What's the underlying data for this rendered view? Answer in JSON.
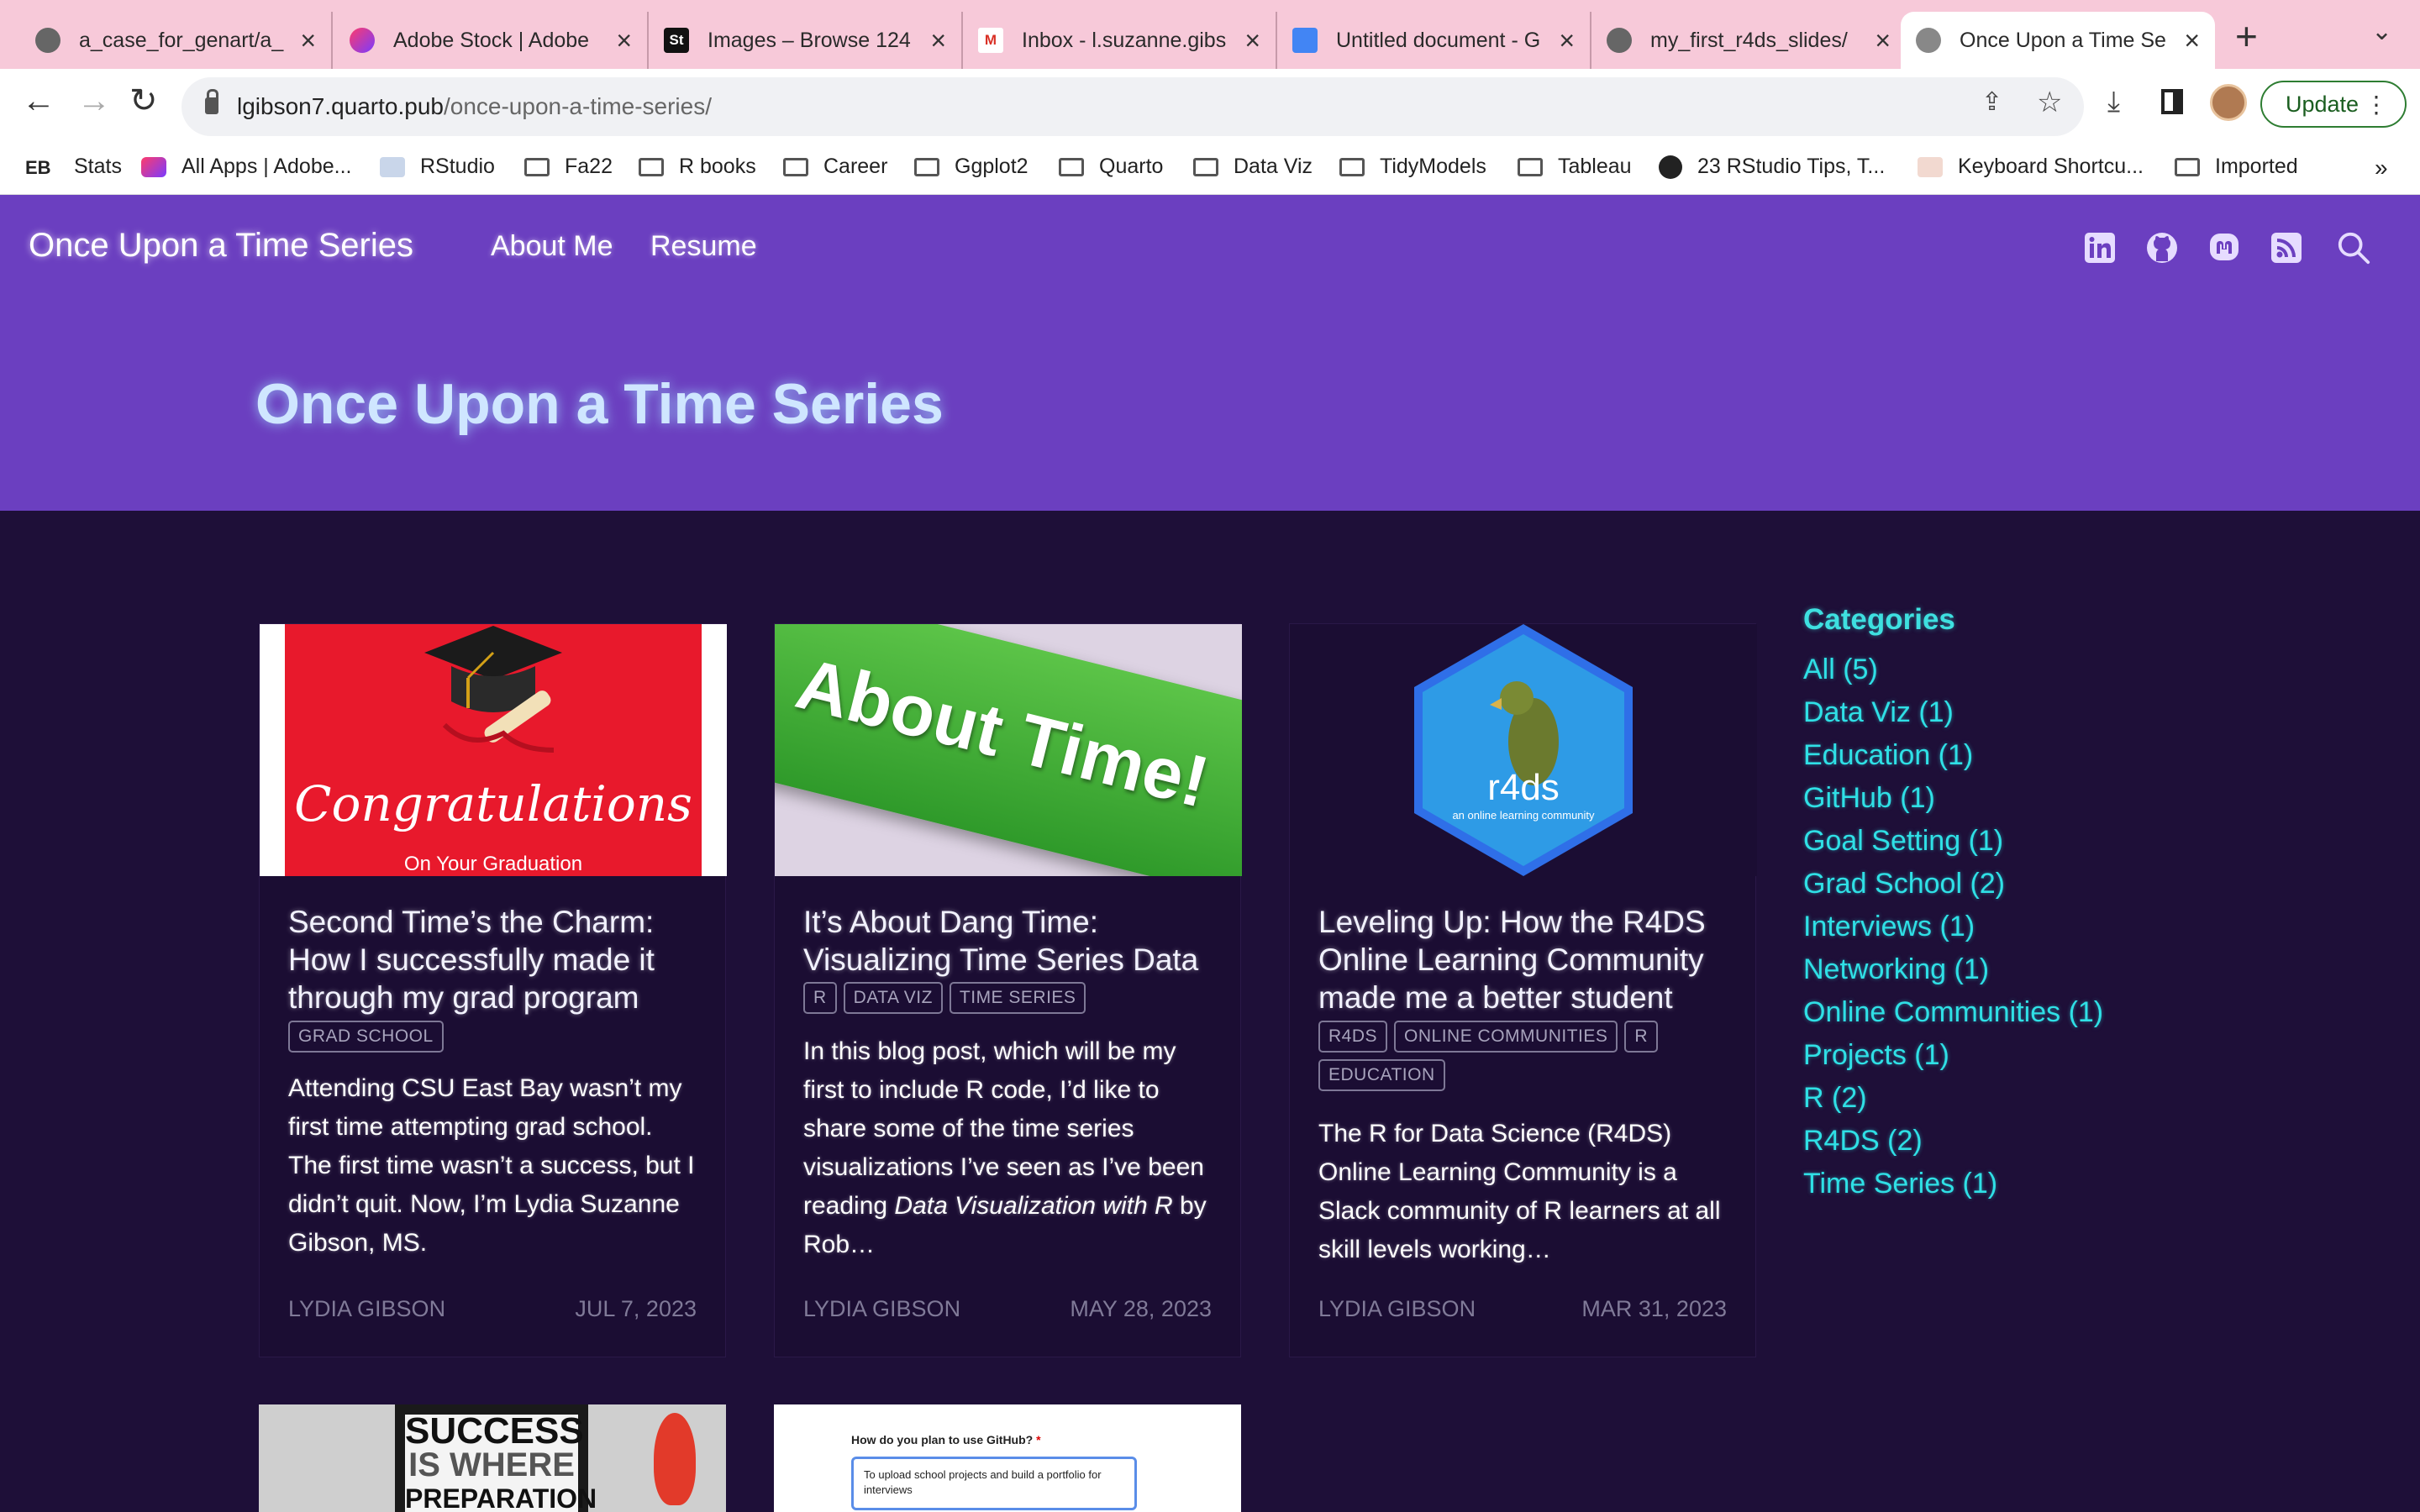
{
  "browser": {
    "tabs": [
      {
        "title": "a_case_for_genart/a_",
        "icon": "github-icon"
      },
      {
        "title": "Adobe Stock | Adobe",
        "icon": "adobe-cc-icon"
      },
      {
        "title": "Images – Browse 124",
        "icon": "adobe-stock-icon",
        "badge": "St"
      },
      {
        "title": "Inbox - l.suzanne.gibs",
        "icon": "gmail-icon",
        "badge": "M"
      },
      {
        "title": "Untitled document - G",
        "icon": "google-docs-icon"
      },
      {
        "title": "my_first_r4ds_slides/",
        "icon": "github-icon"
      },
      {
        "title": "Once Upon a Time Se",
        "icon": "globe-icon"
      }
    ],
    "address": {
      "host": "lgibson7.quarto.pub",
      "path": "/once-upon-a-time-series/"
    },
    "update_label": "Update",
    "bookmarks": [
      {
        "label": "Stats",
        "badge": "EB"
      },
      {
        "label": "All Apps | Adobe..."
      },
      {
        "label": "RStudio"
      },
      {
        "label": "Fa22"
      },
      {
        "label": "R books"
      },
      {
        "label": "Career"
      },
      {
        "label": "Ggplot2"
      },
      {
        "label": "Quarto"
      },
      {
        "label": "Data Viz"
      },
      {
        "label": "TidyModels"
      },
      {
        "label": "Tableau"
      },
      {
        "label": "23 RStudio Tips, T..."
      },
      {
        "label": "Keyboard Shortcu..."
      },
      {
        "label": "Imported"
      }
    ],
    "more_bookmarks": "»"
  },
  "site": {
    "brand": "Once Upon a Time Series",
    "nav": [
      "About Me",
      "Resume"
    ],
    "social_icons": [
      "linkedin-icon",
      "github-icon",
      "mastodon-icon",
      "rss-icon",
      "search-icon"
    ],
    "hero_title": "Once Upon a Time Series"
  },
  "posts": [
    {
      "title": "Second Time’s the Charm: How I successfully made it through my grad program",
      "categories": [
        "GRAD SCHOOL"
      ],
      "description": "Attending CSU East Bay wasn’t my first time attempting grad school. The first time wasn’t a success, but I didn’t quit. Now, I’m Lydia Suzanne Gibson, MS.",
      "author": "LYDIA GIBSON",
      "date": "JUL 7, 2023",
      "thumb_text": "Congratulations",
      "thumb_sub": "On Your Graduation"
    },
    {
      "title": "It’s About Dang Time: Visualizing Time Series Data",
      "categories": [
        "R",
        "DATA VIZ",
        "TIME SERIES"
      ],
      "description_pre": "In this blog post, which will be my first to include R code, I’d like to share some of the time series visualizations I’ve seen as I’ve been reading ",
      "description_em": "Data Visualization with R",
      "description_post": " by Rob…",
      "author": "LYDIA GIBSON",
      "date": "MAY 28, 2023",
      "thumb_text": "About Time!"
    },
    {
      "title": "Leveling Up: How the R4DS Online Learning Community made me a better student",
      "categories": [
        "R4DS",
        "ONLINE COMMUNITIES",
        "R",
        "EDUCATION"
      ],
      "description": "The R for Data Science (R4DS) Online Learning Community is a Slack community of R learners at all skill levels working…",
      "author": "LYDIA GIBSON",
      "date": "MAR 31, 2023",
      "thumb_text": "r4ds",
      "thumb_sub": "an online learning community"
    }
  ],
  "more_posts": [
    {
      "thumb_line1": "SUCCESS",
      "thumb_line2": "IS WHERE",
      "thumb_line3": "PREPARATION"
    },
    {
      "thumb_question": "How do you plan to use GitHub?",
      "thumb_required": "*",
      "thumb_answer": "To upload school projects and build a portfolio for interviews"
    }
  ],
  "sidebar": {
    "heading": "Categories",
    "items": [
      "All (5)",
      "Data Viz (1)",
      "Education (1)",
      "GitHub (1)",
      "Goal Setting (1)",
      "Grad School (2)",
      "Interviews (1)",
      "Networking (1)",
      "Online Communities (1)",
      "Projects (1)",
      "R (2)",
      "R4DS (2)",
      "Time Series (1)"
    ]
  },
  "colors": {
    "brand_purple": "#6b3fc0",
    "page_bg": "#1e0f38",
    "accent_cyan": "#2fe0e6"
  }
}
